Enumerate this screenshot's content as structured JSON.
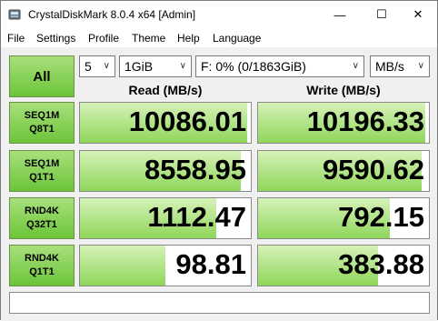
{
  "window": {
    "title": "CrystalDiskMark 8.0.4 x64 [Admin]",
    "minimize_glyph": "—",
    "maximize_glyph": "☐",
    "close_glyph": "✕"
  },
  "menu": [
    "File",
    "Settings",
    "Profile",
    "Theme",
    "Help",
    "Language"
  ],
  "controls": {
    "all_label": "All",
    "count": "5",
    "size": "1GiB",
    "drive": "F: 0% (0/1863GiB)",
    "unit": "MB/s"
  },
  "headers": {
    "read": "Read (MB/s)",
    "write": "Write (MB/s)"
  },
  "tests": [
    {
      "line1": "SEQ1M",
      "line2": "Q8T1",
      "read": "10086.01",
      "write": "10196.33",
      "read_fill": 0.98,
      "write_fill": 0.98
    },
    {
      "line1": "SEQ1M",
      "line2": "Q1T1",
      "read": "8558.95",
      "write": "9590.62",
      "read_fill": 0.94,
      "write_fill": 0.96
    },
    {
      "line1": "RND4K",
      "line2": "Q32T1",
      "read": "1112.47",
      "write": "792.15",
      "read_fill": 0.8,
      "write_fill": 0.77
    },
    {
      "line1": "RND4K",
      "line2": "Q1T1",
      "read": "98.81",
      "write": "383.88",
      "read_fill": 0.5,
      "write_fill": 0.7
    }
  ],
  "comment": "",
  "colors": {
    "accent_green": "#6cc43a",
    "fill_green": "#8fd65a"
  }
}
